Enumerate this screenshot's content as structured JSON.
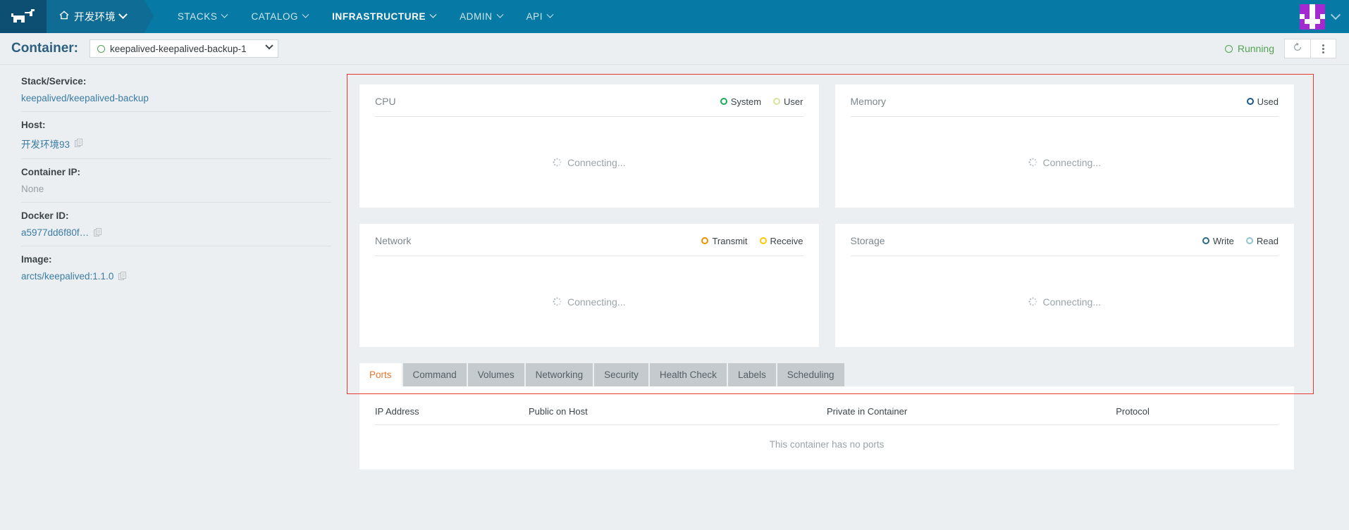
{
  "navbar": {
    "logo_icon": "rancher-cow-logo",
    "environment": {
      "label": "开发环境",
      "home_icon": "home-icon",
      "caret_icon": "chevron-down-icon"
    },
    "items": [
      {
        "label": "STACKS",
        "active": false
      },
      {
        "label": "CATALOG",
        "active": false
      },
      {
        "label": "INFRASTRUCTURE",
        "active": true
      },
      {
        "label": "ADMIN",
        "active": false
      },
      {
        "label": "API",
        "active": false
      }
    ],
    "avatar_icon": "user-avatar-identicon",
    "avatar_color": "#a32ad0",
    "avatar_caret_icon": "chevron-down-icon"
  },
  "container_header": {
    "title": "Container:",
    "selected": "keepalived-keepalived-backup-1",
    "select_caret_icon": "chevron-down-icon",
    "status": "Running",
    "status_color": "#51a351",
    "refresh_icon": "restart-icon",
    "menu_icon": "kebab-menu-icon"
  },
  "sidebar": {
    "blocks": [
      {
        "label": "Stack/Service:",
        "value": "keepalived/keepalived-backup",
        "link": true,
        "copy": false
      },
      {
        "label": "Host:",
        "value": "开发环境93",
        "link": true,
        "copy": true
      },
      {
        "label": "Container IP:",
        "value": "None",
        "link": false,
        "copy": false
      },
      {
        "label": "Docker ID:",
        "value": "a5977dd6f80f…",
        "link": true,
        "copy": true
      },
      {
        "label": "Image:",
        "value": "arcts/keepalived:1.1.0",
        "link": true,
        "copy": true
      }
    ],
    "copy_icon": "copy-to-clipboard-icon"
  },
  "graphs": {
    "loading_text": "Connecting...",
    "spinner_icon": "loading-spinner-icon",
    "cards": [
      {
        "title": "CPU",
        "legend": [
          {
            "label": "System",
            "color": "#1fa854"
          },
          {
            "label": "User",
            "color": "#d8e39a"
          }
        ]
      },
      {
        "title": "Memory",
        "legend": [
          {
            "label": "Used",
            "color": "#17568f"
          }
        ]
      },
      {
        "title": "Network",
        "legend": [
          {
            "label": "Transmit",
            "color": "#e79200"
          },
          {
            "label": "Receive",
            "color": "#ffc800"
          }
        ]
      },
      {
        "title": "Storage",
        "legend": [
          {
            "label": "Write",
            "color": "#2a6a86"
          },
          {
            "label": "Read",
            "color": "#8fc6d2"
          }
        ]
      }
    ]
  },
  "tabs": {
    "items": [
      {
        "label": "Ports",
        "active": true
      },
      {
        "label": "Command",
        "active": false
      },
      {
        "label": "Volumes",
        "active": false
      },
      {
        "label": "Networking",
        "active": false
      },
      {
        "label": "Security",
        "active": false
      },
      {
        "label": "Health Check",
        "active": false
      },
      {
        "label": "Labels",
        "active": false
      },
      {
        "label": "Scheduling",
        "active": false
      }
    ]
  },
  "ports_table": {
    "columns": [
      "IP Address",
      "Public on Host",
      "Private in Container",
      "Protocol"
    ],
    "rows": [],
    "empty_message": "This container has no ports"
  },
  "annotation": {
    "highlight_color": "#e8392e"
  }
}
